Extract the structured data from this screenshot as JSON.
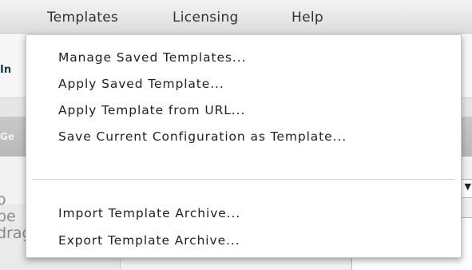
{
  "menubar": {
    "items": [
      {
        "label": "Templates"
      },
      {
        "label": "Licensing"
      },
      {
        "label": "Help"
      }
    ]
  },
  "background": {
    "panel_title": "In",
    "tab_label": "Ge",
    "help_text": "o\npe\ndrag an"
  },
  "templates_menu": {
    "group1": [
      {
        "label": "Manage Saved Templates..."
      },
      {
        "label": "Apply Saved Template..."
      },
      {
        "label": "Apply Template from URL..."
      },
      {
        "label": "Save Current Configuration as Template..."
      }
    ],
    "group2": [
      {
        "label": "Import Template Archive..."
      },
      {
        "label": "Export Template Archive..."
      }
    ]
  }
}
